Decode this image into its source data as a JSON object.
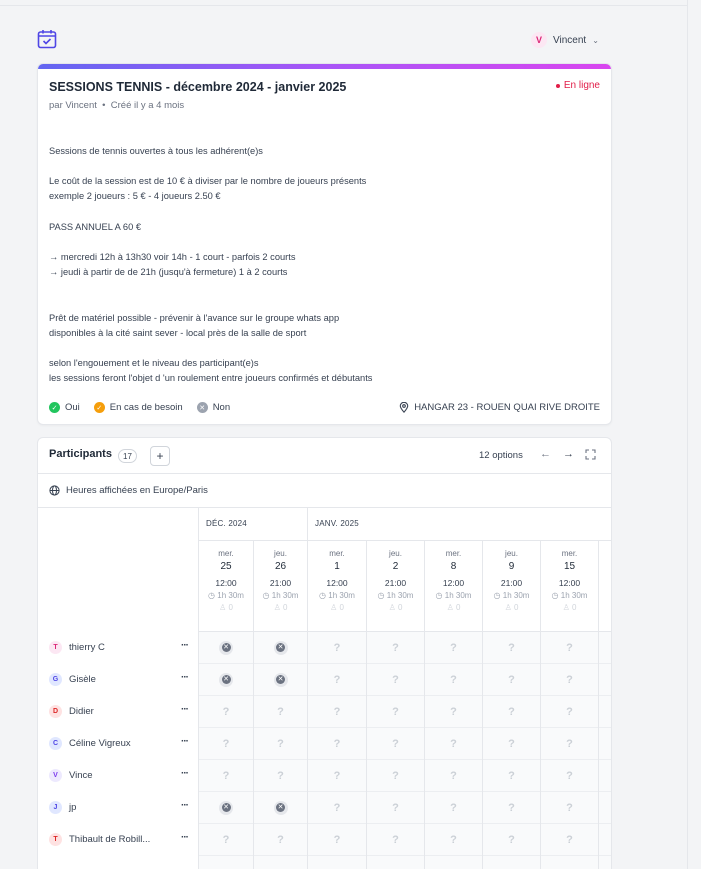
{
  "header": {
    "user_initial": "V",
    "user_name": "Vincent"
  },
  "poll": {
    "title": "SESSIONS TENNIS - décembre 2024 - janvier 2025",
    "status": "En ligne",
    "author": "par Vincent",
    "created": "Créé il y a 4 mois",
    "description": [
      "Sessions de tennis ouvertes à tous les adhérent(e)s",
      "",
      "Le coût de la session est de 10 € à diviser par le nombre de joueurs présents",
      "exemple 2 joueurs : 5 € - 4 joueurs 2.50 €",
      "",
      "PASS ANNUEL A 60 €",
      "",
      "→ mercredi 12h à 13h30 voir 14h - 1 court - parfois 2 courts",
      "→ jeudi à partir de de 21h (jusqu'à fermeture) 1 à 2 courts",
      "",
      "",
      "Prêt de matériel possible - prévenir à l'avance sur le groupe whats app",
      "disponibles à la cité saint sever - local près de la salle de sport",
      "",
      "selon l'engouement et le niveau des participant(e)s",
      "les sessions feront l'objet d 'un roulement entre joueurs confirmés et débutants"
    ],
    "legend": {
      "yes": "Oui",
      "maybe": "En cas de besoin",
      "no": "Non"
    },
    "location": "HANGAR 23 - ROUEN QUAI RIVE DROITE",
    "colors": {
      "yes": "#22c55e",
      "maybe": "#f59e0b",
      "no": "#9ca3af",
      "status": "#e11d48"
    }
  },
  "participants": {
    "title": "Participants",
    "count": "17",
    "add_label": "+",
    "options": "12 options",
    "timezone": "Heures affichées en Europe/Paris",
    "months": [
      "DÉC. 2024",
      "JANV. 2025"
    ],
    "days": [
      {
        "dow": "mer.",
        "num": "25",
        "time": "12:00",
        "dur": "1h 30m",
        "ppl": "0"
      },
      {
        "dow": "jeu.",
        "num": "26",
        "time": "21:00",
        "dur": "1h 30m",
        "ppl": "0"
      },
      {
        "dow": "mer.",
        "num": "1",
        "time": "12:00",
        "dur": "1h 30m",
        "ppl": "0"
      },
      {
        "dow": "jeu.",
        "num": "2",
        "time": "21:00",
        "dur": "1h 30m",
        "ppl": "0"
      },
      {
        "dow": "mer.",
        "num": "8",
        "time": "12:00",
        "dur": "1h 30m",
        "ppl": "0"
      },
      {
        "dow": "jeu.",
        "num": "9",
        "time": "21:00",
        "dur": "1h 30m",
        "ppl": "0"
      },
      {
        "dow": "mer.",
        "num": "15",
        "time": "12:00",
        "dur": "1h 30m",
        "ppl": "0"
      }
    ],
    "people": [
      {
        "initial": "T",
        "name": "thierry C",
        "votes": [
          "no",
          "no",
          "?",
          "?",
          "?",
          "?",
          "?"
        ]
      },
      {
        "initial": "G",
        "name": "Gisèle",
        "votes": [
          "no",
          "no",
          "?",
          "?",
          "?",
          "?",
          "?"
        ]
      },
      {
        "initial": "D",
        "name": "Didier",
        "votes": [
          "?",
          "?",
          "?",
          "?",
          "?",
          "?",
          "?"
        ]
      },
      {
        "initial": "C",
        "name": "Céline Vigreux",
        "votes": [
          "?",
          "?",
          "?",
          "?",
          "?",
          "?",
          "?"
        ]
      },
      {
        "initial": "V",
        "name": "Vince",
        "votes": [
          "?",
          "?",
          "?",
          "?",
          "?",
          "?",
          "?"
        ]
      },
      {
        "initial": "J",
        "name": "jp",
        "votes": [
          "no",
          "no",
          "?",
          "?",
          "?",
          "?",
          "?"
        ]
      },
      {
        "initial": "T",
        "name": "Thibault de Robill...",
        "votes": [
          "?",
          "?",
          "?",
          "?",
          "?",
          "?",
          "?"
        ]
      }
    ],
    "more_label": "···"
  }
}
